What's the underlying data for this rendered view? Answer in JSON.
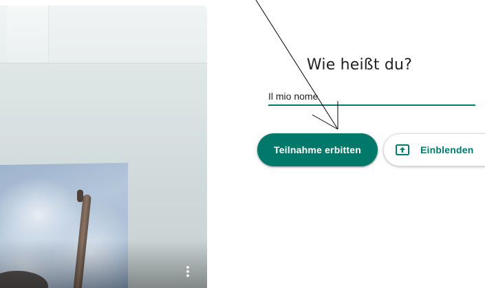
{
  "title": "Wie heißt du?",
  "name_input": {
    "value": "Il mio nome",
    "placeholder": ""
  },
  "buttons": {
    "join_label": "Teilnahme erbitten",
    "present_label": "Einblenden"
  },
  "icons": {
    "more": "more-vert-icon",
    "present": "present-upload-icon"
  },
  "colors": {
    "accent": "#00796b",
    "text": "#202124",
    "spellcheck": "#d93025"
  }
}
